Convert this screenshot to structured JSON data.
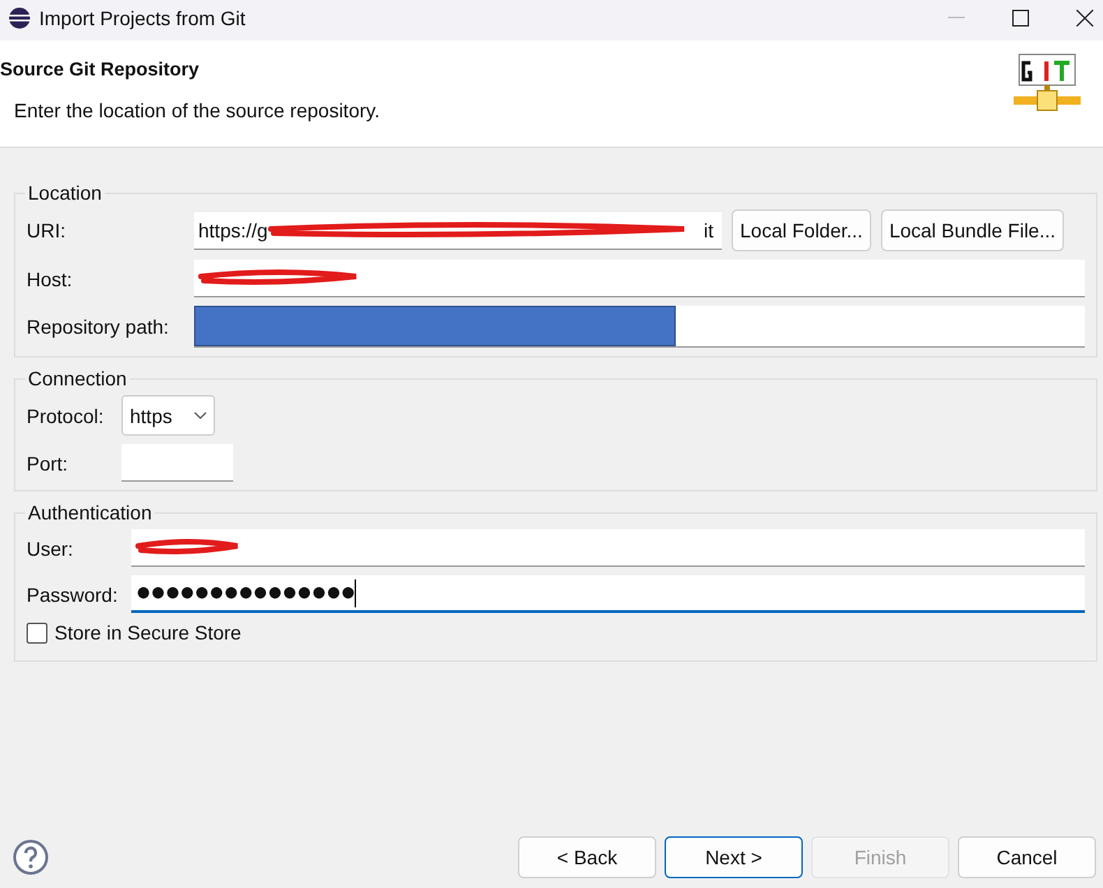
{
  "window": {
    "title": "Import Projects from Git"
  },
  "header": {
    "title": "Source Git Repository",
    "description": "Enter the location of the source repository."
  },
  "location": {
    "title": "Location",
    "uri": {
      "label": "URI:",
      "value": "https://g",
      "tail": "it",
      "kind": "scribble"
    },
    "buttons": [
      {
        "label": "Local Folder..."
      },
      {
        "label": "Local Bundle File..."
      }
    ],
    "host": {
      "label": "Host:",
      "kind": "scribble"
    },
    "repository_path": {
      "label": "Repository path:",
      "kind": "block"
    }
  },
  "connection": {
    "title": "Connection",
    "protocol": {
      "label": "Protocol:",
      "value": "https"
    },
    "port": {
      "label": "Port:"
    }
  },
  "authentication": {
    "title": "Authentication",
    "user": {
      "label": "User:",
      "kind": "scribble"
    },
    "password": {
      "label": "Password:",
      "value": "●●●●●●●●●●●●●●●",
      "focused": true
    },
    "store": {
      "label": "Store in Secure Store",
      "checked": false
    }
  },
  "buttons": [
    {
      "label": "< Back",
      "disabled": false,
      "default": false
    },
    {
      "label": "Next >",
      "disabled": false,
      "default": true
    },
    {
      "label": "Finish",
      "disabled": true,
      "default": false
    },
    {
      "label": "Cancel",
      "disabled": false,
      "default": false
    }
  ]
}
